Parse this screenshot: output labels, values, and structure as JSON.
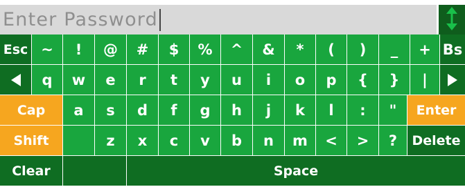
{
  "password_field": {
    "placeholder": "Enter Password"
  },
  "toggle": {
    "icon": "up-down-arrows-icon"
  },
  "rows": [
    [
      {
        "name": "key-esc",
        "label": "Esc",
        "color": "d"
      },
      {
        "name": "key-tilde",
        "label": "~",
        "color": "g"
      },
      {
        "name": "key-exclamation",
        "label": "!",
        "color": "g"
      },
      {
        "name": "key-at",
        "label": "@",
        "color": "g"
      },
      {
        "name": "key-hash",
        "label": "#",
        "color": "g"
      },
      {
        "name": "key-dollar",
        "label": "$",
        "color": "g"
      },
      {
        "name": "key-percent",
        "label": "%",
        "color": "g"
      },
      {
        "name": "key-caret",
        "label": "^",
        "color": "g"
      },
      {
        "name": "key-ampersand",
        "label": "&",
        "color": "g"
      },
      {
        "name": "key-asterisk",
        "label": "*",
        "color": "g"
      },
      {
        "name": "key-left-paren",
        "label": "(",
        "color": "g"
      },
      {
        "name": "key-right-paren",
        "label": ")",
        "color": "g"
      },
      {
        "name": "key-underscore",
        "label": "_",
        "color": "g"
      },
      {
        "name": "key-plus",
        "label": "+",
        "color": "g"
      },
      {
        "name": "key-backspace",
        "label": "Bs",
        "color": "d"
      }
    ],
    [
      {
        "name": "key-left-arrow",
        "icon": "left-arrow-icon",
        "color": "d"
      },
      {
        "name": "key-q",
        "label": "q",
        "color": "g"
      },
      {
        "name": "key-w",
        "label": "w",
        "color": "g"
      },
      {
        "name": "key-e",
        "label": "e",
        "color": "g"
      },
      {
        "name": "key-r",
        "label": "r",
        "color": "g"
      },
      {
        "name": "key-t",
        "label": "t",
        "color": "g"
      },
      {
        "name": "key-y",
        "label": "y",
        "color": "g"
      },
      {
        "name": "key-u",
        "label": "u",
        "color": "g"
      },
      {
        "name": "key-i",
        "label": "i",
        "color": "g"
      },
      {
        "name": "key-o",
        "label": "o",
        "color": "g"
      },
      {
        "name": "key-p",
        "label": "p",
        "color": "g"
      },
      {
        "name": "key-left-brace",
        "label": "{",
        "color": "g"
      },
      {
        "name": "key-right-brace",
        "label": "}",
        "color": "g"
      },
      {
        "name": "key-pipe",
        "label": "|",
        "color": "g"
      },
      {
        "name": "key-right-arrow",
        "icon": "right-arrow-icon",
        "color": "d"
      }
    ],
    [
      {
        "name": "key-caps",
        "label": "Cap",
        "color": "o"
      },
      {
        "name": "key-a",
        "label": "a",
        "color": "g"
      },
      {
        "name": "key-s",
        "label": "s",
        "color": "g"
      },
      {
        "name": "key-d",
        "label": "d",
        "color": "g"
      },
      {
        "name": "key-f",
        "label": "f",
        "color": "g"
      },
      {
        "name": "key-g",
        "label": "g",
        "color": "g"
      },
      {
        "name": "key-h",
        "label": "h",
        "color": "g"
      },
      {
        "name": "key-j",
        "label": "j",
        "color": "g"
      },
      {
        "name": "key-k",
        "label": "k",
        "color": "g"
      },
      {
        "name": "key-l",
        "label": "l",
        "color": "g"
      },
      {
        "name": "key-colon",
        "label": ":",
        "color": "g"
      },
      {
        "name": "key-quote",
        "label": "\"",
        "color": "g"
      },
      {
        "name": "key-enter",
        "label": "Enter",
        "color": "o"
      }
    ],
    [
      {
        "name": "key-shift",
        "label": "Shift",
        "color": "o"
      },
      {
        "name": "key-blank",
        "label": "",
        "color": "g"
      },
      {
        "name": "key-z",
        "label": "z",
        "color": "g"
      },
      {
        "name": "key-x",
        "label": "x",
        "color": "g"
      },
      {
        "name": "key-c",
        "label": "c",
        "color": "g"
      },
      {
        "name": "key-v",
        "label": "v",
        "color": "g"
      },
      {
        "name": "key-b",
        "label": "b",
        "color": "g"
      },
      {
        "name": "key-n",
        "label": "n",
        "color": "g"
      },
      {
        "name": "key-m",
        "label": "m",
        "color": "g"
      },
      {
        "name": "key-less-than",
        "label": "<",
        "color": "g"
      },
      {
        "name": "key-greater-than",
        "label": ">",
        "color": "g"
      },
      {
        "name": "key-question",
        "label": "?",
        "color": "g"
      },
      {
        "name": "key-delete",
        "label": "Delete",
        "color": "d"
      }
    ],
    [
      {
        "name": "key-clear",
        "label": "Clear",
        "color": "d"
      },
      {
        "name": "key-blank-bottom",
        "label": "",
        "color": "d"
      },
      {
        "name": "key-space",
        "label": "Space",
        "color": "d"
      }
    ]
  ],
  "colors": {
    "green": "#19a63e",
    "dark_green": "#0f6d22",
    "orange": "#f6a61f",
    "field_bg": "#d9d9d9"
  }
}
